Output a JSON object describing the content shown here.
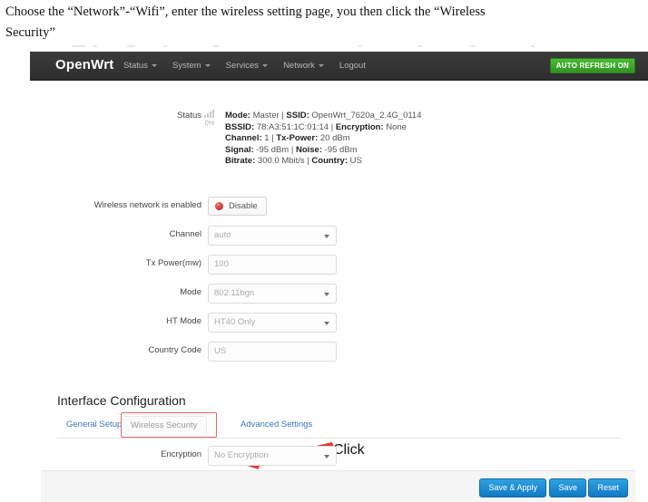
{
  "document": {
    "instruction_line1": "Choose the “Network”-“Wifi”, enter the wireless setting page, you then click the “Wireless",
    "instruction_line2": "Security”"
  },
  "topbar": {
    "brand": "OpenWrt",
    "nav": [
      {
        "label": "Status",
        "has_caret": true
      },
      {
        "label": "System",
        "has_caret": true
      },
      {
        "label": "Services",
        "has_caret": true
      },
      {
        "label": "Network",
        "has_caret": true
      },
      {
        "label": "Logout",
        "has_caret": false
      }
    ],
    "refresh_badge": "AUTO REFRESH ON",
    "badge_color": "#3ea82b",
    "bar_color": "#333333"
  },
  "status": {
    "label": "Status",
    "signal_percent": "0%",
    "icon": "signal-bars-icon",
    "lines": [
      {
        "k1": "Mode:",
        "v1": " Master | ",
        "k2": "SSID:",
        "v2": " OpenWrt_7620a_2.4G_0114"
      },
      {
        "k1": "BSSID:",
        "v1": " 78:A3:51:1C:01:14 | ",
        "k2": "Encryption:",
        "v2": " None"
      },
      {
        "k1": "Channel:",
        "v1": " 1 | ",
        "k2": "Tx-Power:",
        "v2": " 20 dBm"
      },
      {
        "k1": "Signal:",
        "v1": " -95 dBm | ",
        "k2": "Noise:",
        "v2": " -95 dBm"
      },
      {
        "k1": "Bitrate:",
        "v1": " 300.0 Mbit/s | ",
        "k2": "Country:",
        "v2": " US"
      }
    ]
  },
  "form": {
    "enabled": {
      "label": "Wireless network is enabled",
      "button_label": "Disable",
      "button_icon": "red-circle-icon"
    },
    "channel": {
      "label": "Channel",
      "value": "auto",
      "type": "select"
    },
    "txpower": {
      "label": "Tx Power(mw)",
      "value": "100",
      "type": "text"
    },
    "mode": {
      "label": "Mode",
      "value": "802.11bgn",
      "type": "select"
    },
    "htmode": {
      "label": "HT Mode",
      "value": "HT40 Only",
      "type": "select"
    },
    "country": {
      "label": "Country Code",
      "value": "US",
      "type": "text"
    }
  },
  "interface_config": {
    "title": "Interface Configuration",
    "tabs": [
      {
        "label": "General Setup",
        "state": "link"
      },
      {
        "label": "Wireless Security",
        "state": "current"
      },
      {
        "label": "Advanced Settings",
        "state": "link"
      }
    ],
    "encryption": {
      "label": "Encryption",
      "value": "No Encryption",
      "type": "select"
    }
  },
  "annotation": {
    "click_label": "Click",
    "arrow_color": "#e03a2f",
    "highlight_color": "#e46a6a"
  },
  "footer": {
    "save_apply": "Save & Apply",
    "save": "Save",
    "reset": "Reset",
    "button_color": "#1179c4"
  }
}
